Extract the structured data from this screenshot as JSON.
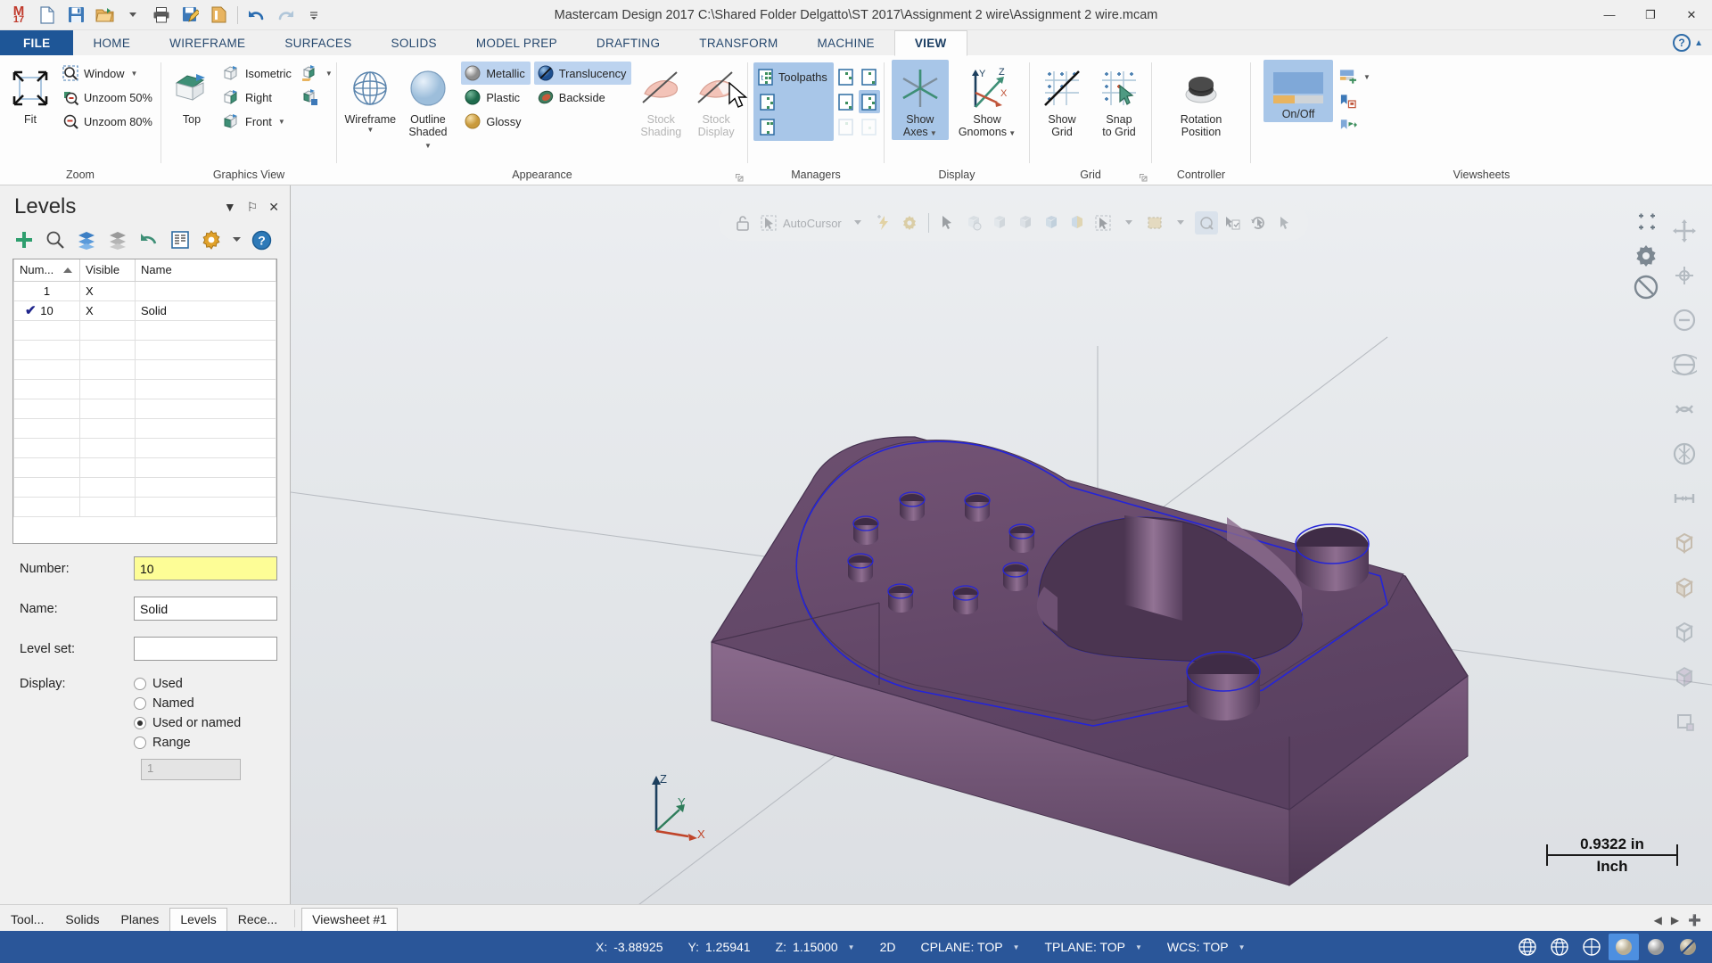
{
  "window": {
    "title": "Mastercam Design 2017  C:\\Shared Folder Delgatto\\ST 2017\\Assignment 2 wire\\Assignment 2 wire.mcam",
    "logo": "M",
    "logo_year": "17",
    "minimize": "—",
    "maximize": "❐",
    "close": "✕",
    "qat": [
      {
        "name": "new-file",
        "icon": "new-file-icon"
      },
      {
        "name": "save",
        "icon": "save-icon"
      },
      {
        "name": "open",
        "icon": "open-folder-icon"
      },
      {
        "name": "open-dropdown",
        "icon": "chevron-down-icon"
      },
      {
        "name": "print",
        "icon": "printer-icon"
      },
      {
        "name": "save-as",
        "icon": "save-edit-icon"
      },
      {
        "name": "file-props",
        "icon": "file-properties-icon"
      },
      {
        "name": "undo",
        "icon": "undo-icon"
      },
      {
        "name": "redo",
        "icon": "redo-icon"
      },
      {
        "name": "customize-qat",
        "icon": "overflow-icon"
      }
    ]
  },
  "ribbon": {
    "tabs": [
      {
        "label": "FILE",
        "active": false,
        "file": true
      },
      {
        "label": "HOME",
        "active": false
      },
      {
        "label": "WIREFRAME",
        "active": false
      },
      {
        "label": "SURFACES",
        "active": false
      },
      {
        "label": "SOLIDS",
        "active": false
      },
      {
        "label": "MODEL PREP",
        "active": false
      },
      {
        "label": "DRAFTING",
        "active": false
      },
      {
        "label": "TRANSFORM",
        "active": false
      },
      {
        "label": "MACHINE",
        "active": false
      },
      {
        "label": "VIEW",
        "active": true
      }
    ],
    "help_label": "?",
    "collapse_label": "▲",
    "groups": {
      "zoom": {
        "label": "Zoom",
        "fit": "Fit",
        "window": "Window",
        "unzoom50": "Unzoom 50%",
        "unzoom80": "Unzoom 80%"
      },
      "graphics_view": {
        "label": "Graphics View",
        "top": "Top",
        "isometric": "Isometric",
        "right": "Right",
        "front": "Front"
      },
      "appearance": {
        "label": "Appearance",
        "wireframe": "Wireframe",
        "outline_shaded": "Outline\nShaded",
        "outline_shaded_l1": "Outline",
        "outline_shaded_l2": "Shaded",
        "metallic": "Metallic",
        "plastic": "Plastic",
        "glossy": "Glossy",
        "translucency": "Translucency",
        "backside": "Backside",
        "stock_shading_l1": "Stock",
        "stock_shading_l2": "Shading",
        "stock_display_l1": "Stock",
        "stock_display_l2": "Display"
      },
      "managers": {
        "label": "Managers",
        "toolpaths": "Toolpaths"
      },
      "display": {
        "label": "Display",
        "show_axes_l1": "Show",
        "show_axes_l2": "Axes",
        "show_gnomons_l1": "Show",
        "show_gnomons_l2": "Gnomons",
        "axis_y": "Y",
        "axis_z": "Z",
        "axis_x": "X"
      },
      "grid": {
        "label": "Grid",
        "show_grid_l1": "Show",
        "show_grid_l2": "Grid",
        "snap_to_grid_l1": "Snap",
        "snap_to_grid_l2": "to Grid"
      },
      "controller": {
        "label": "Controller",
        "rotation_position_l1": "Rotation",
        "rotation_position_l2": "Position"
      },
      "viewsheets": {
        "label": "Viewsheets",
        "onoff": "On/Off"
      }
    }
  },
  "levels_panel": {
    "title": "Levels",
    "header_buttons": [
      {
        "name": "panel-menu-button",
        "glyph": "▼"
      },
      {
        "name": "pin-panel-button",
        "glyph": "⚐"
      },
      {
        "name": "close-panel-button",
        "glyph": "✕"
      }
    ],
    "toolbar": [
      {
        "name": "add-level-button",
        "icon": "plus-icon"
      },
      {
        "name": "find-level-button",
        "icon": "magnifier-icon"
      },
      {
        "name": "show-all-levels-button",
        "icon": "layers-blue-icon"
      },
      {
        "name": "hide-all-levels-button",
        "icon": "layers-gray-icon"
      },
      {
        "name": "undo-levels-button",
        "icon": "undo-arrow-icon"
      },
      {
        "name": "level-list-button",
        "icon": "list-icon"
      },
      {
        "name": "level-options-button",
        "icon": "gear-icon"
      },
      {
        "name": "level-options-dropdown",
        "icon": "chevron-down-icon"
      },
      {
        "name": "levels-help-button",
        "icon": "help-icon"
      }
    ],
    "grid": {
      "columns": [
        "Num...",
        "Visible",
        "Name"
      ],
      "sorted_column": 0,
      "rows": [
        {
          "selected": false,
          "number": "1",
          "visible": "X",
          "name": ""
        },
        {
          "selected": true,
          "number": "10",
          "visible": "X",
          "name": "Solid"
        }
      ],
      "empty_rows": 10
    },
    "form": {
      "number_label": "Number:",
      "number_value": "10",
      "name_label": "Name:",
      "name_value": "Solid",
      "level_set_label": "Level set:",
      "level_set_value": "",
      "display_label": "Display:",
      "display_options": [
        {
          "label": "Used",
          "selected": false
        },
        {
          "label": "Named",
          "selected": false
        },
        {
          "label": "Used or named",
          "selected": true
        },
        {
          "label": "Range",
          "selected": false
        }
      ],
      "range_value": "1"
    }
  },
  "viewport": {
    "float_toolbar": {
      "lock_icon": "lock-icon",
      "autocursor_label": "AutoCursor",
      "items": [
        {
          "name": "autocursor-dropdown",
          "icon": "chevron-down-icon"
        },
        {
          "name": "quick-point",
          "icon": "lightning-icon"
        },
        {
          "name": "autocursor-settings",
          "icon": "gear-icon"
        },
        {
          "name": "select-arrow",
          "icon": "arrow-select-icon"
        },
        {
          "name": "select-entity",
          "icon": "entity-select-icon"
        },
        {
          "name": "select-face",
          "icon": "face-select-icon"
        },
        {
          "name": "select-solid",
          "icon": "solid-select-icon"
        },
        {
          "name": "select-body",
          "icon": "body-select-icon"
        },
        {
          "name": "select-partial",
          "icon": "partial-select-icon"
        },
        {
          "name": "select-all",
          "icon": "select-all-icon"
        },
        {
          "name": "select-all-dropdown",
          "icon": "chevron-down-icon"
        },
        {
          "name": "select-window",
          "icon": "marquee-icon"
        },
        {
          "name": "select-window-dropdown",
          "icon": "chevron-down-icon"
        },
        {
          "name": "select-only",
          "icon": "select-only-icon"
        },
        {
          "name": "verify-selection",
          "icon": "clipboard-check-icon"
        },
        {
          "name": "reselect",
          "icon": "reselect-icon"
        },
        {
          "name": "end-selection",
          "icon": "end-select-icon"
        }
      ]
    },
    "gnomon": {
      "x": "X",
      "y": "Y",
      "z": "Z"
    },
    "scale": {
      "value": "0.9322 in",
      "unit": "Inch"
    },
    "right_rail": [
      {
        "name": "fit-view-button",
        "icon": "fit-icon"
      },
      {
        "name": "zoom-target-button",
        "icon": "zoom-target-icon"
      },
      {
        "name": "unzoom-button",
        "icon": "unzoom-icon"
      },
      {
        "name": "dynamic-rotate-button",
        "icon": "rotate-icon"
      },
      {
        "name": "pan-button",
        "icon": "pan-icon"
      },
      {
        "name": "measure-button",
        "icon": "measure-icon"
      },
      {
        "name": "analyze-button",
        "icon": "analyze-icon"
      },
      {
        "name": "section-view-button",
        "icon": "section-icon"
      },
      {
        "name": "shade-button",
        "icon": "shade-icon"
      },
      {
        "name": "wireframe-button",
        "icon": "wireframe-icon"
      },
      {
        "name": "iso-view-button",
        "icon": "iso-view-icon"
      },
      {
        "name": "top-view-button",
        "icon": "top-view-icon"
      }
    ],
    "right_rail2": [
      {
        "name": "snap-options-button",
        "icon": "snap-icon"
      },
      {
        "name": "view-settings-button",
        "icon": "gear-icon"
      },
      {
        "name": "no-entry-button",
        "icon": "no-entry-icon"
      }
    ]
  },
  "bottom_tabs": {
    "left": [
      {
        "label": "Tool...",
        "active": false,
        "name": "tab-toolpaths"
      },
      {
        "label": "Solids",
        "active": false,
        "name": "tab-solids"
      },
      {
        "label": "Planes",
        "active": false,
        "name": "tab-planes"
      },
      {
        "label": "Levels",
        "active": true,
        "name": "tab-levels"
      },
      {
        "label": "Rece...",
        "active": false,
        "name": "tab-recent"
      }
    ],
    "viewsheet": {
      "label": "Viewsheet #1",
      "active": true
    },
    "nav": [
      "◀",
      "▶",
      "➕"
    ]
  },
  "statusbar": {
    "coords": [
      {
        "label": "X:",
        "value": "-3.88925",
        "name": "status-x"
      },
      {
        "label": "Y:",
        "value": "1.25941",
        "name": "status-y"
      },
      {
        "label": "Z:",
        "value": "1.15000",
        "name": "status-z",
        "caret": true
      }
    ],
    "mode": "2D",
    "cplane": "CPLANE: TOP",
    "tplane": "TPLANE: TOP",
    "wcs": "WCS: TOP",
    "icons": [
      {
        "name": "wireframe-display-button",
        "icon": "globe-wire-icon",
        "selected": false
      },
      {
        "name": "hidden-lines-button",
        "icon": "globe-hidden-icon",
        "selected": false
      },
      {
        "name": "shaded-wire-button",
        "icon": "globe-shade-icon",
        "selected": false
      },
      {
        "name": "shaded-solid-button",
        "icon": "sphere-light-icon",
        "selected": true
      },
      {
        "name": "material-button",
        "icon": "sphere-metal-icon",
        "selected": false
      },
      {
        "name": "translucency-button",
        "icon": "sphere-translucent-icon",
        "selected": false
      }
    ]
  },
  "colors": {
    "accent": "#2a5699",
    "file_tab": "#1e5697",
    "ribbon_selected": "#a8c6e8",
    "model_body": "#6b4f6e",
    "model_edge": "#2020c0",
    "highlight_yellow": "#fdfd96"
  }
}
